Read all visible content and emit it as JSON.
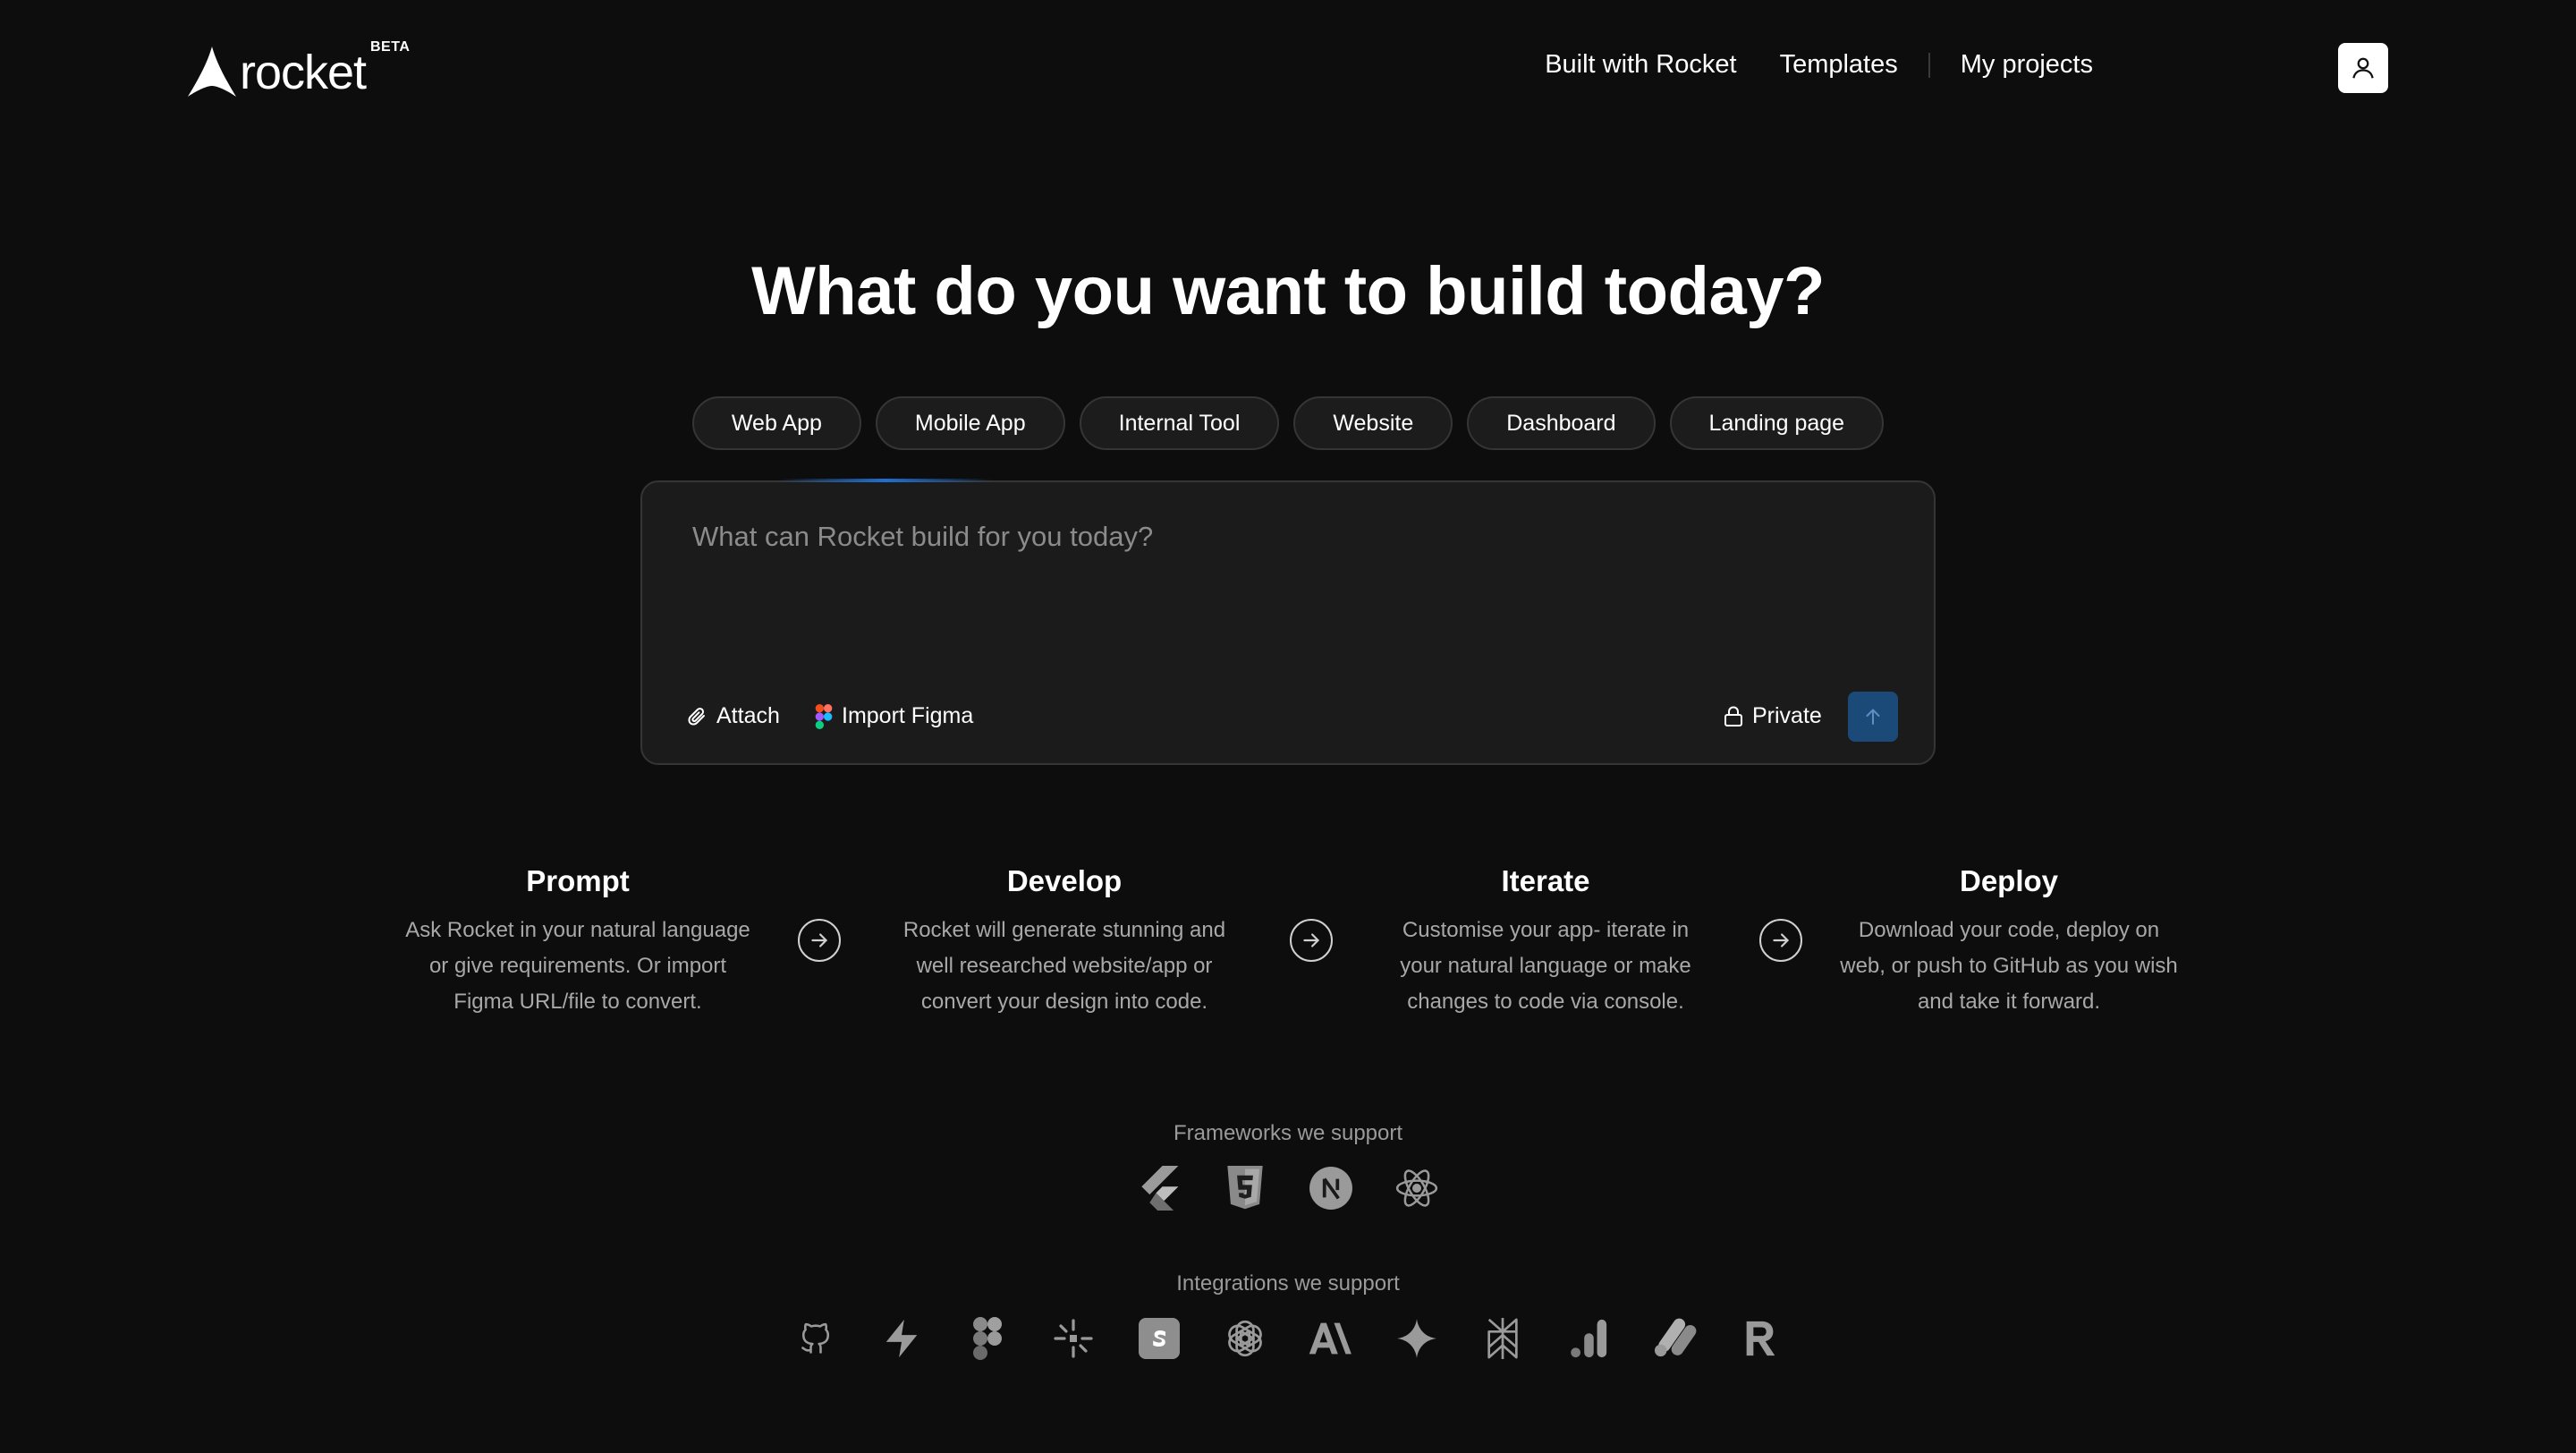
{
  "header": {
    "logo_text": "rocket",
    "beta_badge": "BETA",
    "nav": [
      {
        "label": "Built with Rocket"
      },
      {
        "label": "Templates"
      },
      {
        "label": "My projects"
      }
    ]
  },
  "hero": {
    "title": "What do you want to build today?"
  },
  "tabs": [
    {
      "label": "Web App"
    },
    {
      "label": "Mobile App"
    },
    {
      "label": "Internal Tool"
    },
    {
      "label": "Website"
    },
    {
      "label": "Dashboard"
    },
    {
      "label": "Landing page"
    }
  ],
  "prompt": {
    "placeholder": "What can Rocket build for you today?",
    "attach_label": "Attach",
    "figma_label": "Import Figma",
    "private_label": "Private"
  },
  "steps": [
    {
      "title": "Prompt",
      "description": "Ask Rocket in your natural language or give requirements. Or import Figma URL/file to convert."
    },
    {
      "title": "Develop",
      "description": "Rocket will generate stunning and well researched website/app or convert your design into code."
    },
    {
      "title": "Iterate",
      "description": "Customise your app- iterate in your natural language or make changes to code via console."
    },
    {
      "title": "Deploy",
      "description": "Download your code, deploy on web, or push to GitHub as you wish and take it forward."
    }
  ],
  "frameworks": {
    "label": "Frameworks we support",
    "icons": [
      "flutter-icon",
      "html5-icon",
      "nextjs-icon",
      "react-icon"
    ]
  },
  "integrations": {
    "label": "Integrations we support",
    "icons": [
      "github-icon",
      "supabase-icon",
      "figma-icon",
      "perplexity-spark-icon",
      "stripe-icon",
      "openai-icon",
      "anthropic-icon",
      "gemini-icon",
      "perplexity-icon",
      "google-analytics-icon",
      "adsense-icon",
      "resend-icon"
    ]
  },
  "colors": {
    "background": "#0d0d0d",
    "panel": "#1b1b1b",
    "send_button": "#1c4a78",
    "accent_glow": "#1f6fd1"
  }
}
